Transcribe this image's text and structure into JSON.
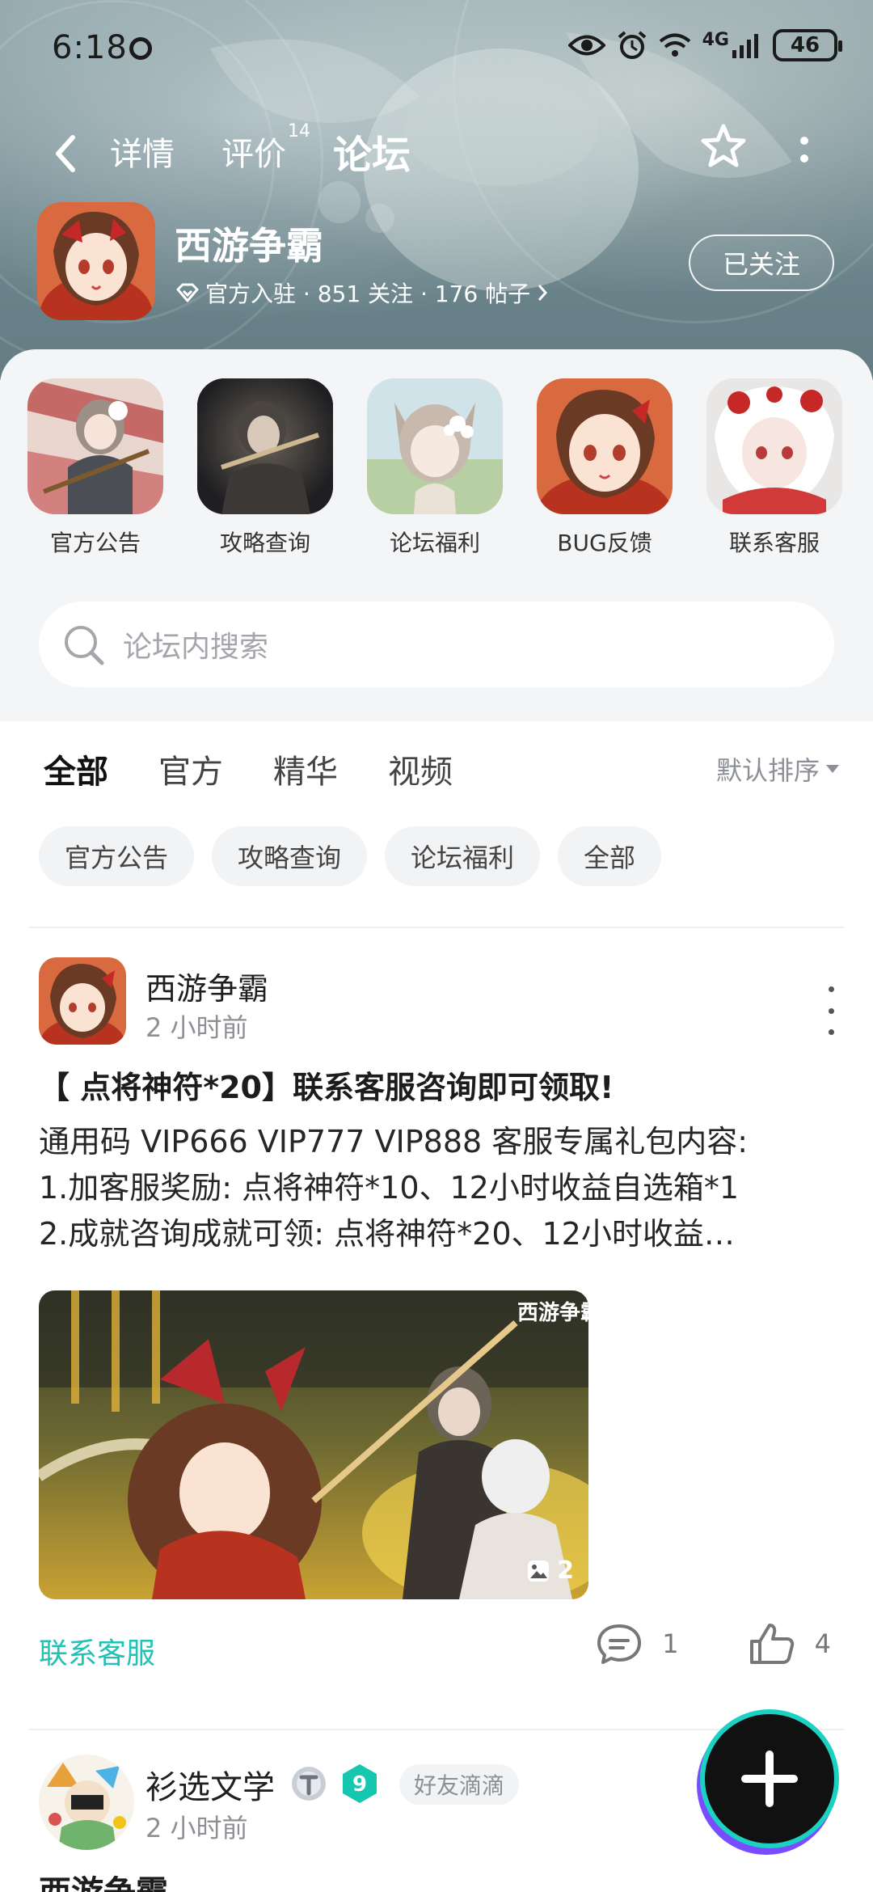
{
  "status_bar": {
    "time": "6:18",
    "network": "4G",
    "battery": "46"
  },
  "top_nav": {
    "tabs": [
      {
        "label": "详情"
      },
      {
        "label": "评价",
        "count": "14"
      },
      {
        "label": "论坛"
      }
    ],
    "active_tab": "论坛"
  },
  "game": {
    "name": "西游争霸",
    "meta": "官方入驻 · 851 关注 · 176 帖子",
    "follow_label": "已关注"
  },
  "shortcuts": [
    {
      "label": "官方公告"
    },
    {
      "label": "攻略查询"
    },
    {
      "label": "论坛福利"
    },
    {
      "label": "BUG反馈"
    },
    {
      "label": "联系客服"
    }
  ],
  "search": {
    "placeholder": "论坛内搜索"
  },
  "feed_tabs": [
    {
      "label": "全部"
    },
    {
      "label": "官方"
    },
    {
      "label": "精华"
    },
    {
      "label": "视频"
    }
  ],
  "sort_label": "默认排序",
  "chips": [
    {
      "label": "官方公告"
    },
    {
      "label": "攻略查询"
    },
    {
      "label": "论坛福利"
    },
    {
      "label": "全部"
    }
  ],
  "post": {
    "author": "西游争霸",
    "time": "2 小时前",
    "title": "【 点将神符*20】联系客服咨询即可领取!",
    "body": [
      "通用码 VIP666 VIP777 VIP888 客服专属礼包内容:",
      "1.加客服奖励:  点将神符*10、12小时收益自选箱*1",
      "2.成就咨询成就可领:   点将神符*20、12小时收益…"
    ],
    "image_count": "2",
    "image_watermark": "西游争霸",
    "tag": "联系客服",
    "comments": "1",
    "likes": "4"
  },
  "post2": {
    "author": "衫选文学",
    "time": "2 小时前",
    "badge_level": "9",
    "friend_tag": "好友滴滴",
    "title": "西游争霸"
  },
  "colors": {
    "accent": "#2ad4c4",
    "tag_text": "#22c1b6"
  }
}
